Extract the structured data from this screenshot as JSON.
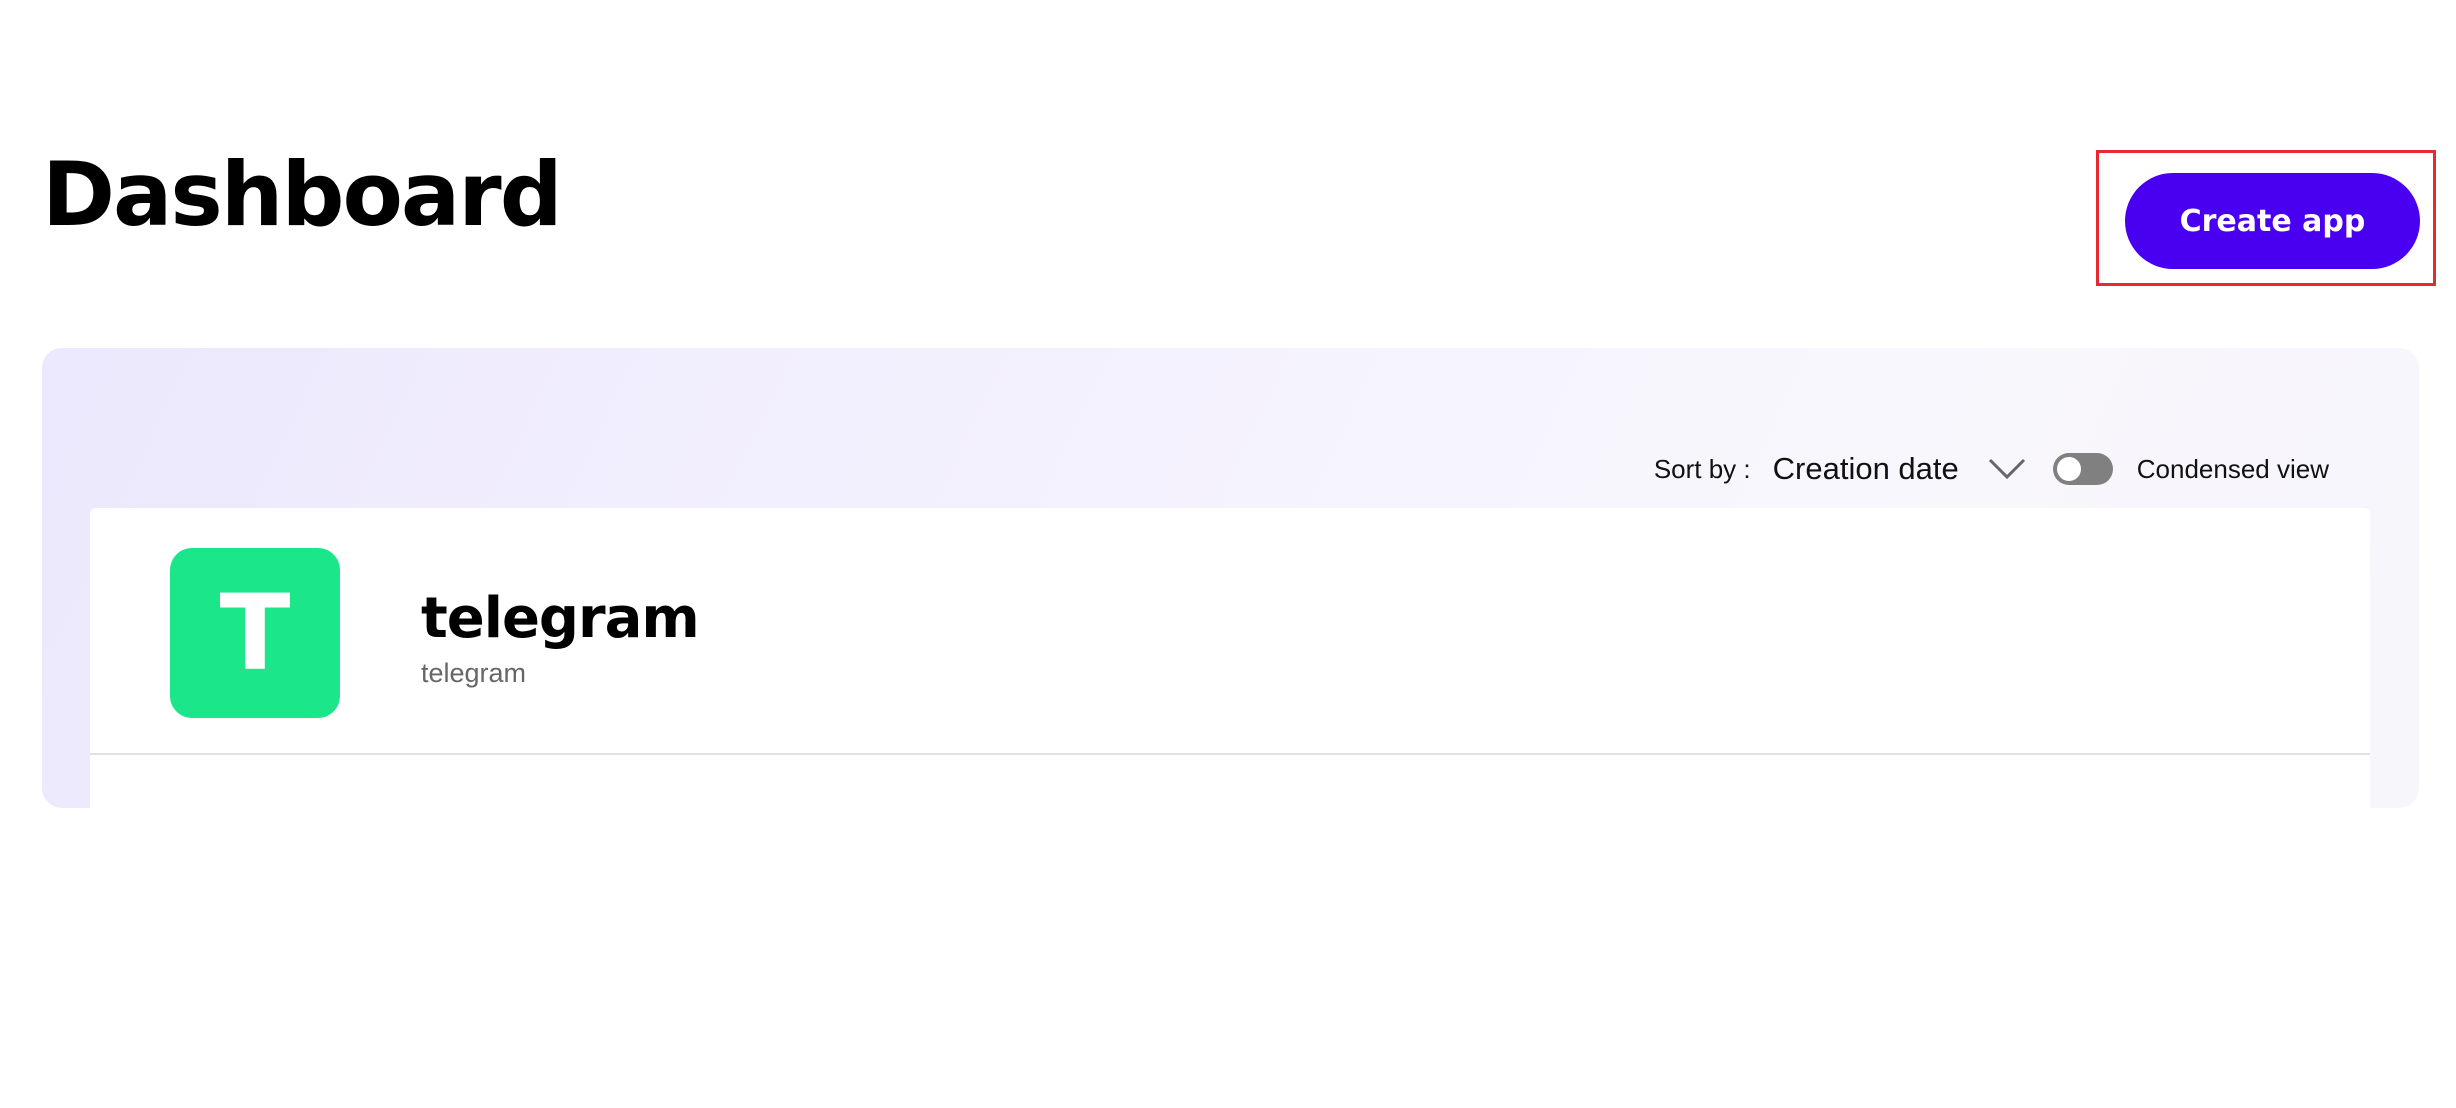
{
  "header": {
    "title": "Dashboard",
    "create_button_label": "Create app"
  },
  "toolbar": {
    "sort_label": "Sort by :",
    "sort_value": "Creation date",
    "sort_icon": "chevron-down-icon",
    "condensed_toggle_on": false,
    "condensed_label": "Condensed view"
  },
  "apps": [
    {
      "avatar_letter": "T",
      "avatar_color": "#1ce68a",
      "name": "telegram",
      "subtitle": "telegram"
    }
  ],
  "colors": {
    "accent": "#4a00f0",
    "highlight": "#e8292d"
  }
}
